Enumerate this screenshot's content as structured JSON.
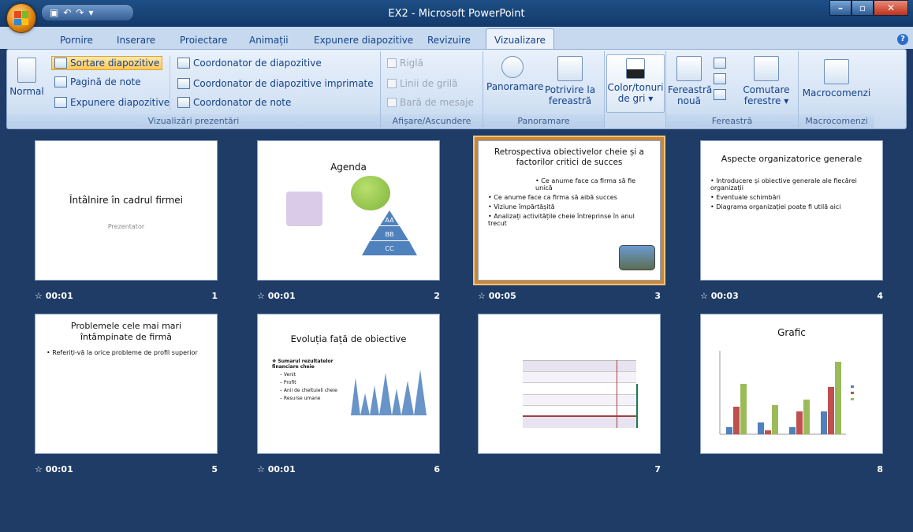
{
  "window": {
    "title": "EX2 - Microsoft PowerPoint"
  },
  "tabs": [
    "Pornire",
    "Inserare",
    "Proiectare",
    "Animații",
    "Expunere diapozitive",
    "Revizuire",
    "Vizualizare"
  ],
  "active_tab": "Vizualizare",
  "ribbon": {
    "presentation_views": {
      "label": "Vizualizări prezentări",
      "normal": "Normal",
      "slide_sorter": "Sortare diapozitive",
      "notes_page": "Pagină de note",
      "slide_show": "Expunere diapozitive",
      "slide_master": "Coordonator de diapozitive",
      "handout_master": "Coordonator de diapozitive imprimate",
      "notes_master": "Coordonator de note"
    },
    "show_hide": {
      "label": "Afișare/Ascundere",
      "ruler": "Riglă",
      "gridlines": "Linii de grilă",
      "message_bar": "Bară de mesaje"
    },
    "zoom": {
      "label": "Panoramare",
      "zoom": "Panoramare",
      "fit_line1": "Potrivire la",
      "fit_line2": "fereastră"
    },
    "color": {
      "line1": "Color/tonuri",
      "line2": "de gri"
    },
    "window": {
      "label": "Fereastră",
      "new_line1": "Fereastră",
      "new_line2": "nouă",
      "switch_line1": "Comutare",
      "switch_line2": "ferestre"
    },
    "macros": {
      "label": "Macrocomenzi",
      "button": "Macrocomenzi"
    }
  },
  "slides": [
    {
      "number": "1",
      "timing": "00:01",
      "title": "Întâlnire în cadrul firmei",
      "subtitle": "Prezentator"
    },
    {
      "number": "2",
      "timing": "00:01",
      "title": "Agenda",
      "pyramid": [
        "AA",
        "BB",
        "CC"
      ]
    },
    {
      "number": "3",
      "timing": "00:05",
      "title": "Retrospectiva obiectivelor cheie și a factorilor critici de succes",
      "bullets": [
        "Ce anume face ca firma să fie unică",
        "Ce anume face ca firma să aibă succes",
        "Viziune împărtășită",
        "Analizați activitățile cheie întreprinse în anul trecut"
      ]
    },
    {
      "number": "4",
      "timing": "00:03",
      "title": "Aspecte organizatorice generale",
      "bullets": [
        "Introducere și obiective generale ale fiecărei organizații",
        "Eventuale schimbări",
        "Diagrama organizației poate fi utilă aici"
      ]
    },
    {
      "number": "5",
      "timing": "00:01",
      "title": "Problemele cele mai mari întâmpinate de firmă",
      "bullets": [
        "Referiți-vă la orice probleme de profil superior"
      ]
    },
    {
      "number": "6",
      "timing": "00:01",
      "title": "Evoluția față de obiective",
      "bullets": [
        "Sumarul rezultatelor financiare cheie",
        "Venit",
        "Profit",
        "Anii de cheltuieli cheie",
        "Resurse umane"
      ]
    },
    {
      "number": "7",
      "timing": ""
    },
    {
      "number": "8",
      "timing": "",
      "title": "Grafic"
    }
  ],
  "colors": {
    "selection": "#c9873c",
    "chart_blue": "#4f81bd",
    "chart_red": "#c0504d",
    "chart_green": "#9bbb59"
  }
}
